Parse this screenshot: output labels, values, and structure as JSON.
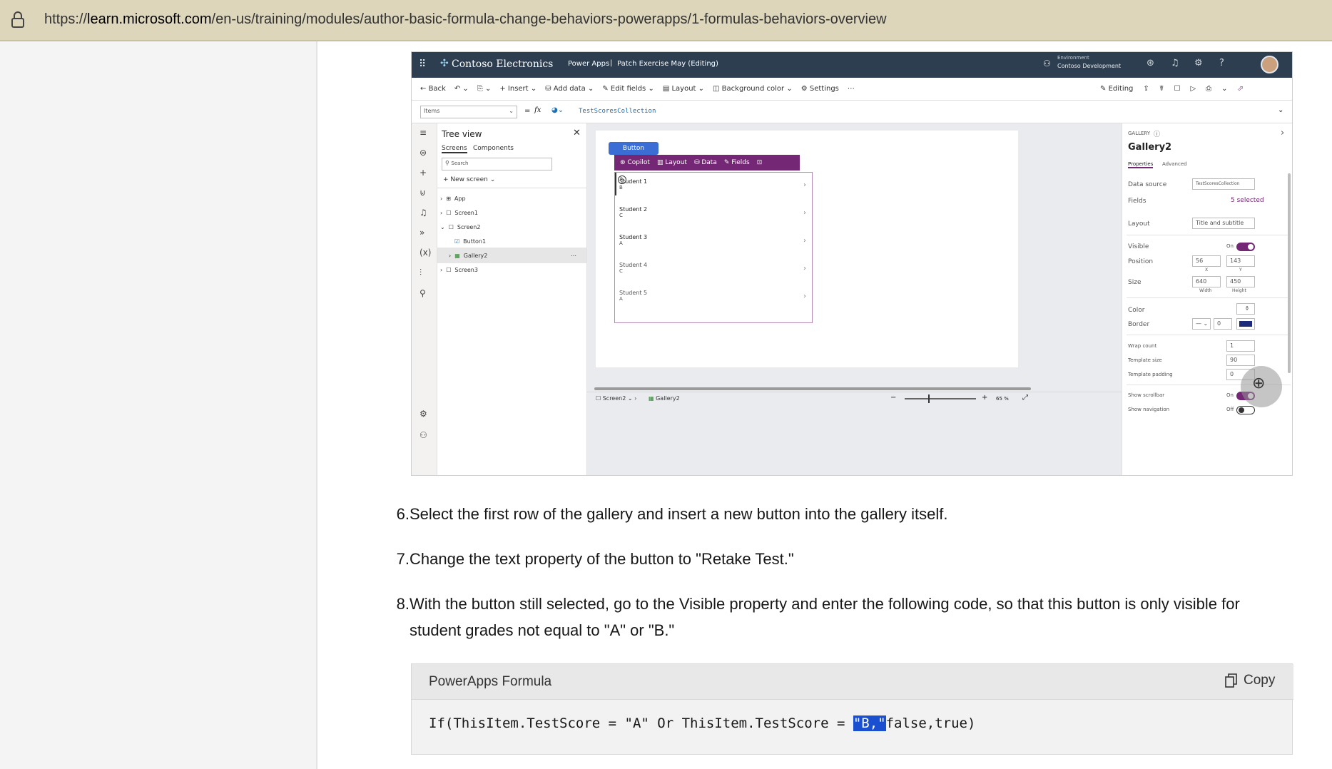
{
  "browser": {
    "url_prefix": "https://",
    "url_domain": "learn.microsoft.com",
    "url_path": "/en-us/training/modules/author-basic-formula-change-behaviors-powerapps/1-formulas-behaviors-overview",
    "lock_icon": "lock-icon"
  },
  "screenshot": {
    "topbar": {
      "app_name": "Contoso Electronics",
      "product": "Power Apps",
      "separator": "|",
      "app_title": "Patch Exercise May (Editing)",
      "env_label": "Environment",
      "env_name": "Contoso Development"
    },
    "command_bar": {
      "back": "Back",
      "insert": "Insert",
      "add_data": "Add data",
      "edit_fields": "Edit fields",
      "layout": "Layout",
      "background_color": "Background color",
      "settings": "Settings",
      "editing": "Editing"
    },
    "formula_bar": {
      "property": "Items",
      "equals": "=",
      "fx": "fx",
      "formula": "TestScoresCollection"
    },
    "tree_view": {
      "title": "Tree view",
      "tab_screens": "Screens",
      "tab_components": "Components",
      "search_placeholder": "Search",
      "new_screen": "New screen",
      "items": [
        "App",
        "Screen1",
        "Screen2",
        "Button1",
        "Gallery2",
        "Screen3"
      ]
    },
    "canvas": {
      "button_label": "Button",
      "toolbar": [
        "Copilot",
        "Layout",
        "Data",
        "Fields"
      ],
      "students": [
        {
          "name": "Student 1",
          "grade": "B"
        },
        {
          "name": "Student 2",
          "grade": "C"
        },
        {
          "name": "Student 3",
          "grade": "A"
        },
        {
          "name": "Student 4",
          "grade": "C"
        },
        {
          "name": "Student 5",
          "grade": "A"
        }
      ]
    },
    "status_bar": {
      "screen": "Screen2",
      "gallery": "Gallery2",
      "zoom_minus": "−",
      "zoom_plus": "+",
      "zoom": "65 %"
    },
    "properties": {
      "kind": "GALLERY",
      "title": "Gallery2",
      "tab_properties": "Properties",
      "tab_advanced": "Advanced",
      "data_source_label": "Data source",
      "data_source_value": "TestScoresCollection",
      "fields_label": "Fields",
      "fields_value": "5 selected",
      "layout_label": "Layout",
      "layout_value": "Title and subtitle",
      "visible_label": "Visible",
      "visible_value": "On",
      "position_label": "Position",
      "position_x": "56",
      "position_y": "143",
      "x_label": "X",
      "y_label": "Y",
      "size_label": "Size",
      "size_w": "640",
      "size_h": "450",
      "width_label": "Width",
      "height_label": "Height",
      "color_label": "Color",
      "border_label": "Border",
      "border_value": "0",
      "wrap_label": "Wrap count",
      "wrap_value": "1",
      "template_size_label": "Template size",
      "template_size_value": "90",
      "template_padding_label": "Template padding",
      "template_padding_value": "0",
      "scrollbar_label": "Show scrollbar",
      "scrollbar_value": "On",
      "navigation_label": "Show navigation",
      "navigation_value": "Off"
    }
  },
  "steps": [
    {
      "num": "6.",
      "text": "Select the first row of the gallery and insert a new button into the gallery itself."
    },
    {
      "num": "7.",
      "text": "Change the text property of the button to \"Retake Test.\""
    },
    {
      "num": "8.",
      "text": "With the button still selected, go to the Visible property and enter the following code, so that this button is only visible for student grades not equal to \"A\" or \"B.\""
    }
  ],
  "code": {
    "language": "PowerApps Formula",
    "copy_label": "Copy",
    "before": "If(ThisItem.TestScore = \"A\" Or ThisItem.TestScore = ",
    "selected": "\"B,\"",
    "after": "false,true)"
  },
  "colors": {
    "accent": "#742774",
    "topbar": "#2d3e50",
    "selection": "#1a4fd0"
  }
}
